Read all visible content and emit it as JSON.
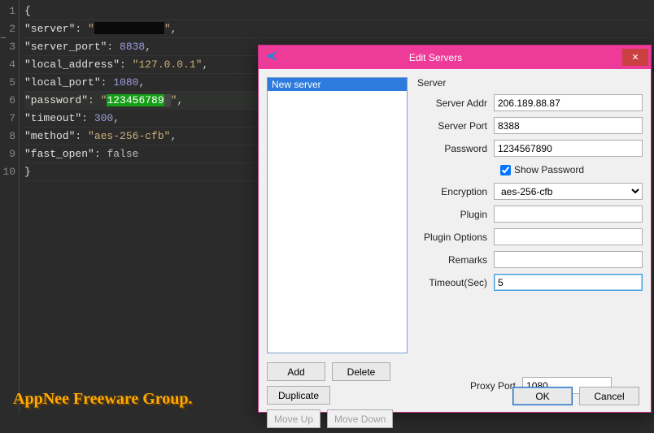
{
  "editor": {
    "lines": [
      {
        "n": "1"
      },
      {
        "n": "2"
      },
      {
        "n": "3"
      },
      {
        "n": "4"
      },
      {
        "n": "5"
      },
      {
        "n": "6"
      },
      {
        "n": "7"
      },
      {
        "n": "8"
      },
      {
        "n": "9"
      },
      {
        "n": "10"
      }
    ],
    "keys": {
      "server": "\"server\"",
      "server_port": "\"server_port\"",
      "local_address": "\"local_address\"",
      "local_port": "\"local_port\"",
      "password": "\"password\"",
      "timeout": "\"timeout\"",
      "method": "\"method\"",
      "fast_open": "\"fast_open\""
    },
    "vals": {
      "server_port": "8838",
      "local_address": "\"127.0.0.1\"",
      "local_port": "1080",
      "password_hl": "123456789",
      "timeout": "300",
      "method": "\"aes-256-cfb\"",
      "fast_open": "false"
    },
    "open_brace": "{",
    "close_brace": "}",
    "q": "\"",
    "comma": ",",
    "colon_sp": ": "
  },
  "dialog": {
    "title": "Edit Servers",
    "list": {
      "item0": "New server"
    },
    "group_title": "Server",
    "labels": {
      "addr": "Server Addr",
      "port": "Server Port",
      "password": "Password",
      "showpw": "Show Password",
      "enc": "Encryption",
      "plugin": "Plugin",
      "pluginopt": "Plugin Options",
      "remarks": "Remarks",
      "timeout": "Timeout(Sec)",
      "proxy": "Proxy Port"
    },
    "values": {
      "addr": "206.189.88.87",
      "port": "8388",
      "password": "1234567890",
      "enc": "aes-256-cfb",
      "plugin": "",
      "pluginopt": "",
      "remarks": "",
      "timeout": "5",
      "proxy": "1080"
    },
    "buttons": {
      "add": "Add",
      "delete": "Delete",
      "duplicate": "Duplicate",
      "moveup": "Move Up",
      "movedown": "Move Down",
      "ok": "OK",
      "cancel": "Cancel"
    }
  },
  "watermark": "AppNee Freeware Group."
}
